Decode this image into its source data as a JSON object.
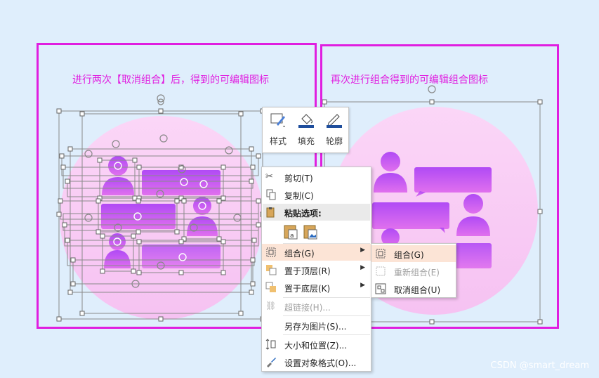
{
  "left_caption": "进行两次【取消组合】后，得到的可编辑图标",
  "right_caption": "再次进行组合得到的可编辑组合图标",
  "ribbon": {
    "style": "样式",
    "fill": "填充",
    "outline": "轮廓"
  },
  "menu": {
    "cut": "剪切(T)",
    "copy": "复制(C)",
    "paste_options": "粘贴选项:",
    "group": "组合(G)",
    "bring_to_front": "置于顶层(R)",
    "send_to_back": "置于底层(K)",
    "hyperlink": "超链接(H)...",
    "save_as_picture": "另存为图片(S)...",
    "size_position": "大小和位置(Z)...",
    "format_object": "设置对象格式(O)..."
  },
  "submenu": {
    "group": "组合(G)",
    "regroup": "重新组合(E)",
    "ungroup": "取消组合(U)"
  },
  "watermark": "CSDN @smart_dream",
  "colors": {
    "accent": "#e01ee0",
    "purple": "#b040f0",
    "highlight": "#fce4d6"
  }
}
